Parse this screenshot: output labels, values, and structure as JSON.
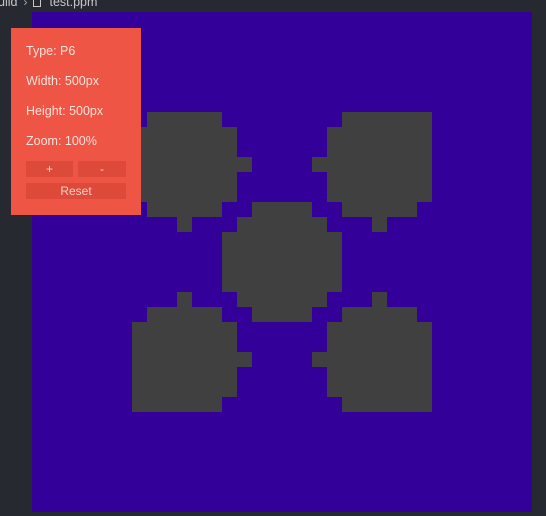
{
  "breadcrumb": {
    "folder": "uild",
    "separator": "›",
    "file_icon": "file-icon",
    "file": "test.ppm"
  },
  "viewer": {
    "background_color": "#330099",
    "shape_color": "#404040"
  },
  "info_panel": {
    "background_color": "#ef5544",
    "type": "Type: P6",
    "width": "Width: 500px",
    "height": "Height: 500px",
    "zoom": "Zoom: 100%",
    "zoom_in_label": "+",
    "zoom_out_label": "-",
    "reset_label": "Reset"
  }
}
